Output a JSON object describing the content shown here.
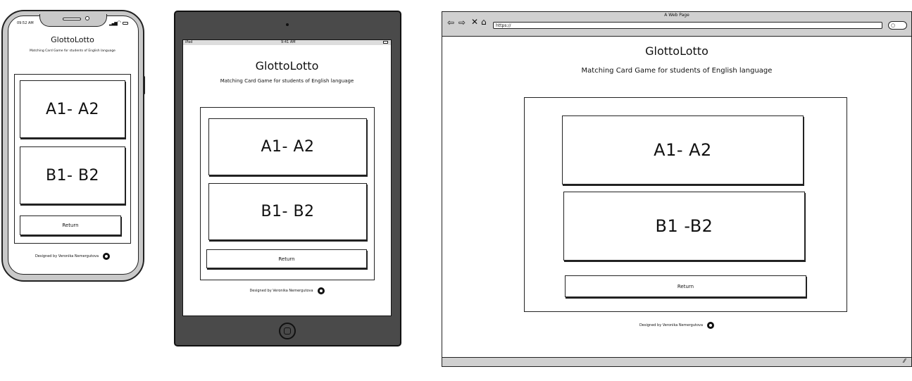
{
  "app": {
    "title": "GlottoLotto",
    "subtitle": "Matching Card Game for students of English language"
  },
  "levels": {
    "a": "A1- A2",
    "b": "B1- B2",
    "b_desktop": "B1 -B2"
  },
  "return_label": "Return",
  "footer_text": "Designed by Veronika Nemergutova",
  "phone": {
    "time": "09:52 AM"
  },
  "tablet": {
    "carrier": "iPad",
    "time": "9:41 AM"
  },
  "browser": {
    "title": "A Web Page",
    "url": "https://"
  },
  "icons": [
    "back-icon",
    "forward-icon",
    "close-icon",
    "home-icon",
    "search-icon",
    "github-icon",
    "home-button-icon",
    "wifi-icon",
    "battery-icon",
    "signal-icon",
    "resize-icon"
  ]
}
